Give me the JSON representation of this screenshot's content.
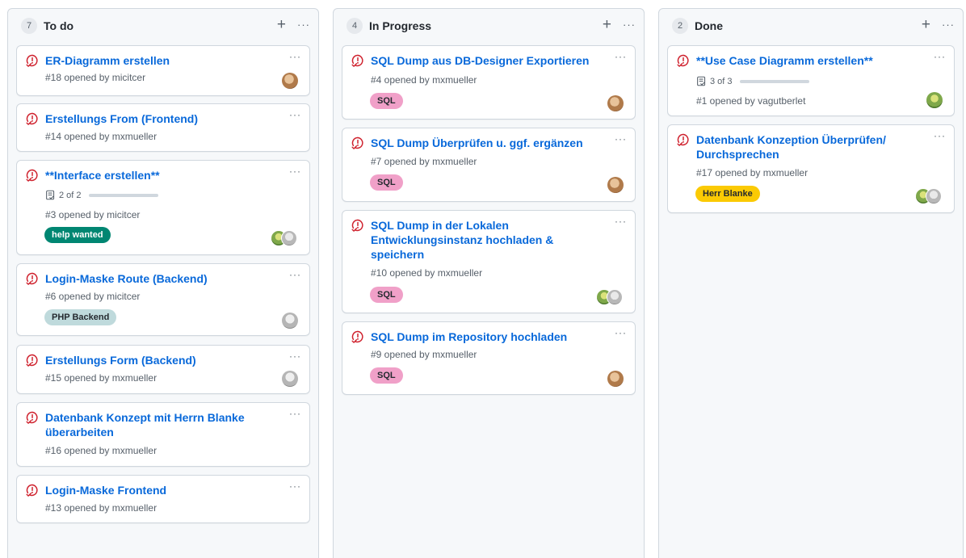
{
  "colors": {
    "issue_open": "#cf222e",
    "link": "#0969da",
    "label_sql": "#f0a0c8",
    "label_help": "#008672",
    "label_php": "#bfdadc",
    "label_blanke": "#fbca04"
  },
  "columns": [
    {
      "count": "7",
      "title": "To do",
      "cards": [
        {
          "title": "ER-Diagramm erstellen",
          "meta": "#18 opened by micitcer"
        },
        {
          "title": "Erstellungs From (Frontend)",
          "meta": "#14 opened by mxmueller"
        },
        {
          "title": "**Interface erstellen**",
          "tasks": "2 of 2",
          "meta": "#3 opened by micitcer",
          "label": "help wanted"
        },
        {
          "title": "Login-Maske Route (Backend)",
          "meta": "#6 opened by micitcer",
          "label": "PHP Backend"
        },
        {
          "title": "Erstellungs Form (Backend)",
          "meta": "#15 opened by mxmueller"
        },
        {
          "title": "Datenbank Konzept mit Herrn Blanke überarbeiten",
          "meta": "#16 opened by mxmueller"
        },
        {
          "title": "Login-Maske Frontend",
          "meta": "#13 opened by mxmueller"
        }
      ]
    },
    {
      "count": "4",
      "title": "In Progress",
      "cards": [
        {
          "title": "SQL Dump aus DB-Designer Exportieren",
          "meta": "#4 opened by mxmueller",
          "label": "SQL"
        },
        {
          "title": "SQL Dump Überprüfen u. ggf. ergänzen",
          "meta": "#7 opened by mxmueller",
          "label": "SQL"
        },
        {
          "title": "SQL Dump in der Lokalen Entwicklungsinstanz hochladen & speichern",
          "meta": "#10 opened by mxmueller",
          "label": "SQL"
        },
        {
          "title": "SQL Dump im Repository hochladen",
          "meta": "#9 opened by mxmueller",
          "label": "SQL"
        }
      ]
    },
    {
      "count": "2",
      "title": "Done",
      "cards": [
        {
          "title": "**Use Case Diagramm erstellen**",
          "tasks": "3 of 3",
          "meta": "#1 opened by vagutberlet"
        },
        {
          "title": "Datenbank Konzeption Überprüfen/ Durchsprechen",
          "meta": "#17 opened by mxmueller",
          "label": "Herr Blanke"
        }
      ]
    }
  ]
}
